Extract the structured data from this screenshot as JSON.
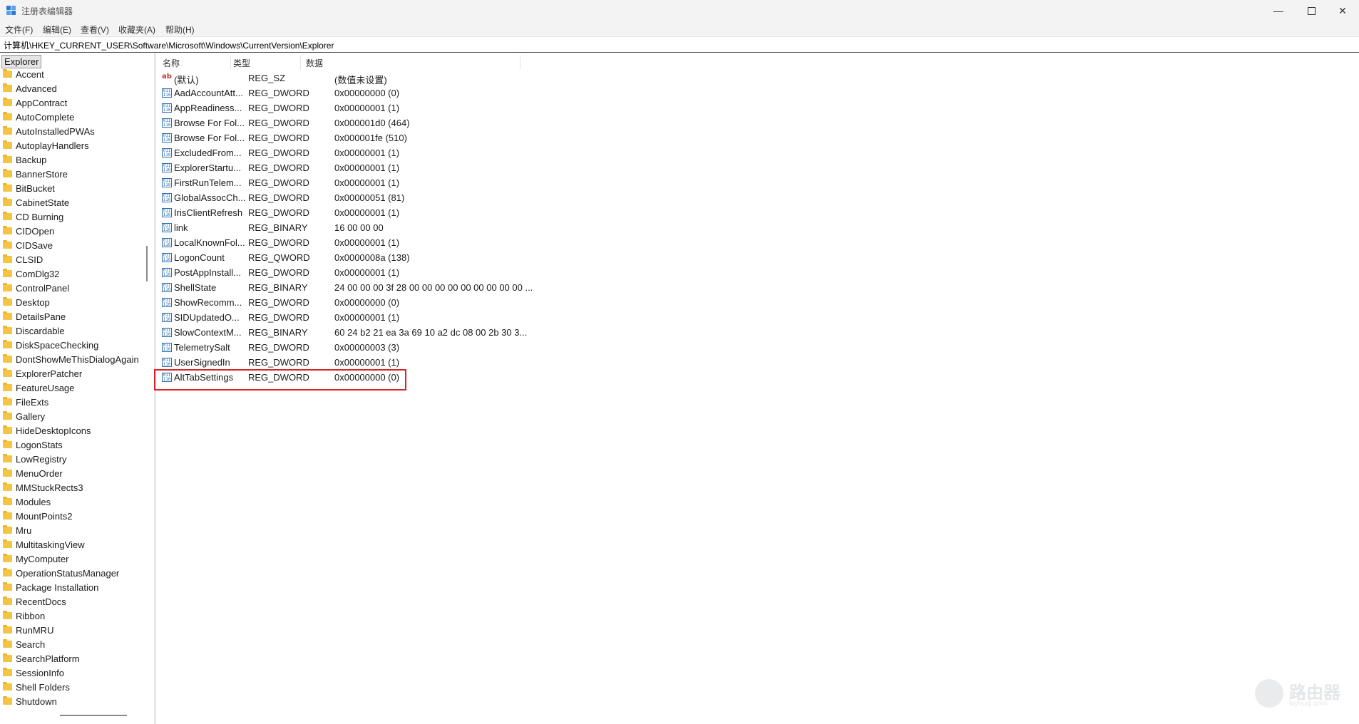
{
  "window": {
    "title": "注册表编辑器"
  },
  "menu": [
    "文件(F)",
    "编辑(E)",
    "查看(V)",
    "收藏夹(A)",
    "帮助(H)"
  ],
  "address": "计算机\\HKEY_CURRENT_USER\\Software\\Microsoft\\Windows\\CurrentVersion\\Explorer",
  "tree": {
    "root": "Explorer",
    "items": [
      "Accent",
      "Advanced",
      "AppContract",
      "AutoComplete",
      "AutoInstalledPWAs",
      "AutoplayHandlers",
      "Backup",
      "BannerStore",
      "BitBucket",
      "CabinetState",
      "CD Burning",
      "CIDOpen",
      "CIDSave",
      "CLSID",
      "ComDlg32",
      "ControlPanel",
      "Desktop",
      "DetailsPane",
      "Discardable",
      "DiskSpaceChecking",
      "DontShowMeThisDialogAgain",
      "ExplorerPatcher",
      "FeatureUsage",
      "FileExts",
      "Gallery",
      "HideDesktopIcons",
      "LogonStats",
      "LowRegistry",
      "MenuOrder",
      "MMStuckRects3",
      "Modules",
      "MountPoints2",
      "Mru",
      "MultitaskingView",
      "MyComputer",
      "OperationStatusManager",
      "Package Installation",
      "RecentDocs",
      "Ribbon",
      "RunMRU",
      "Search",
      "SearchPlatform",
      "SessionInfo",
      "Shell Folders",
      "Shutdown"
    ]
  },
  "columns": {
    "name": "名称",
    "type": "类型",
    "data": "数据"
  },
  "values": [
    {
      "name": "(默认)",
      "type": "REG_SZ",
      "data": "(数值未设置)",
      "icon": "string"
    },
    {
      "name": "AadAccountAtt...",
      "type": "REG_DWORD",
      "data": "0x00000000 (0)",
      "icon": "binary"
    },
    {
      "name": "AppReadiness...",
      "type": "REG_DWORD",
      "data": "0x00000001 (1)",
      "icon": "binary"
    },
    {
      "name": "Browse For Fol...",
      "type": "REG_DWORD",
      "data": "0x000001d0 (464)",
      "icon": "binary"
    },
    {
      "name": "Browse For Fol...",
      "type": "REG_DWORD",
      "data": "0x000001fe (510)",
      "icon": "binary"
    },
    {
      "name": "ExcludedFrom...",
      "type": "REG_DWORD",
      "data": "0x00000001 (1)",
      "icon": "binary"
    },
    {
      "name": "ExplorerStartu...",
      "type": "REG_DWORD",
      "data": "0x00000001 (1)",
      "icon": "binary"
    },
    {
      "name": "FirstRunTelem...",
      "type": "REG_DWORD",
      "data": "0x00000001 (1)",
      "icon": "binary"
    },
    {
      "name": "GlobalAssocCh...",
      "type": "REG_DWORD",
      "data": "0x00000051 (81)",
      "icon": "binary"
    },
    {
      "name": "IrisClientRefresh",
      "type": "REG_DWORD",
      "data": "0x00000001 (1)",
      "icon": "binary"
    },
    {
      "name": "link",
      "type": "REG_BINARY",
      "data": "16 00 00 00",
      "icon": "binary"
    },
    {
      "name": "LocalKnownFol...",
      "type": "REG_DWORD",
      "data": "0x00000001 (1)",
      "icon": "binary"
    },
    {
      "name": "LogonCount",
      "type": "REG_QWORD",
      "data": "0x0000008a (138)",
      "icon": "binary"
    },
    {
      "name": "PostAppInstall...",
      "type": "REG_DWORD",
      "data": "0x00000001 (1)",
      "icon": "binary"
    },
    {
      "name": "ShellState",
      "type": "REG_BINARY",
      "data": "24 00 00 00 3f 28 00 00 00 00 00 00 00 00 00 ...",
      "icon": "binary"
    },
    {
      "name": "ShowRecomm...",
      "type": "REG_DWORD",
      "data": "0x00000000 (0)",
      "icon": "binary"
    },
    {
      "name": "SIDUpdatedO...",
      "type": "REG_DWORD",
      "data": "0x00000001 (1)",
      "icon": "binary"
    },
    {
      "name": "SlowContextM...",
      "type": "REG_BINARY",
      "data": "60 24 b2 21 ea 3a 69 10 a2 dc 08 00 2b 30 3...",
      "icon": "binary"
    },
    {
      "name": "TelemetrySalt",
      "type": "REG_DWORD",
      "data": "0x00000003 (3)",
      "icon": "binary"
    },
    {
      "name": "UserSignedIn",
      "type": "REG_DWORD",
      "data": "0x00000001 (1)",
      "icon": "binary"
    },
    {
      "name": "AltTabSettings",
      "type": "REG_DWORD",
      "data": "0x00000000 (0)",
      "icon": "binary"
    }
  ],
  "watermark": {
    "text": "路由器",
    "sub": "luyouqi.com"
  }
}
